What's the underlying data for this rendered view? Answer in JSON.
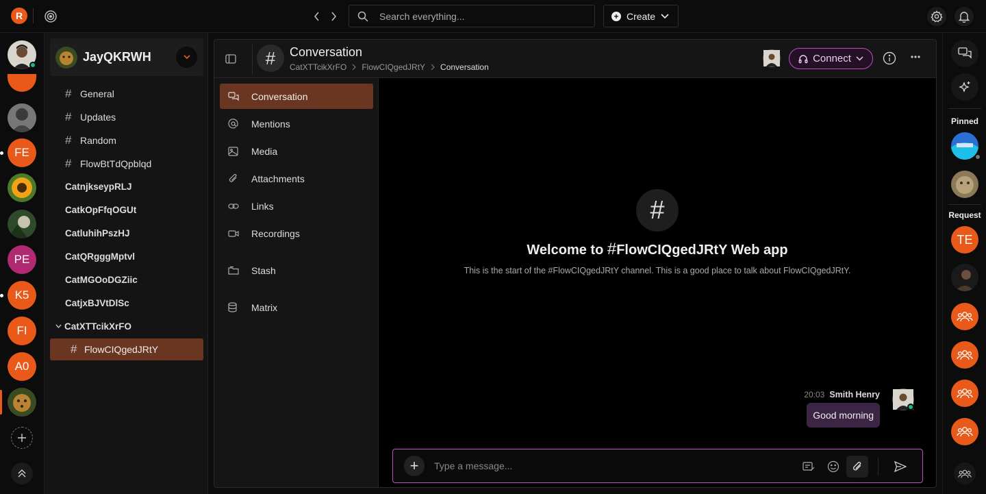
{
  "topbar": {
    "logo_letter": "R",
    "search_placeholder": "Search everything...",
    "create_label": "Create"
  },
  "rail": {
    "items": [
      {
        "initials": "FE"
      },
      {
        "initials": "PE"
      },
      {
        "initials": "K5"
      },
      {
        "initials": "FI"
      },
      {
        "initials": "A0"
      }
    ]
  },
  "workspace": {
    "name": "JayQKRWH",
    "channels": [
      {
        "name": "General"
      },
      {
        "name": "Updates"
      },
      {
        "name": "Random"
      },
      {
        "name": "FlowBtTdQpblqd"
      }
    ],
    "categories": [
      "CatnjkseypRLJ",
      "CatkOpFfqOGUt",
      "CatluhihPszHJ",
      "CatQRgggMptvl",
      "CatMGOoDGZiic",
      "CatjxBJVtDlSc"
    ],
    "expanded_category": "CatXTTcikXrFO",
    "active_channel": "FlowCIQgedJRtY"
  },
  "header": {
    "title": "Conversation",
    "breadcrumb": [
      "CatXTTcikXrFO",
      "FlowCIQgedJRtY",
      "Conversation"
    ],
    "connect_label": "Connect"
  },
  "subnav": [
    {
      "label": "Conversation",
      "icon": "chat-icon"
    },
    {
      "label": "Mentions",
      "icon": "at-icon"
    },
    {
      "label": "Media",
      "icon": "image-icon"
    },
    {
      "label": "Attachments",
      "icon": "paperclip-icon"
    },
    {
      "label": "Links",
      "icon": "link-icon"
    },
    {
      "label": "Recordings",
      "icon": "video-icon"
    },
    {
      "label": "Stash",
      "icon": "folder-icon"
    },
    {
      "label": "Matrix",
      "icon": "database-icon"
    }
  ],
  "welcome": {
    "prefix": "Welcome to ",
    "channel": "FlowCIQgedJRtY Web app",
    "subtitle": "This is the start of the #FlowCIQgedJRtY channel. This is a good place to talk about FlowCIQgedJRtY."
  },
  "message": {
    "time": "20:03",
    "author": "Smith Henry",
    "text": "Good morning"
  },
  "composer": {
    "placeholder": "Type a message..."
  },
  "rightrail": {
    "pinned_label": "Pinned",
    "request_label": "Request",
    "request_initials": "TE"
  },
  "colors": {
    "accent": "#e8591a",
    "active_bg": "#6b3621",
    "connect_border": "#c04cc8",
    "bubble_bg": "#3c2444",
    "online": "#1fb58f"
  }
}
